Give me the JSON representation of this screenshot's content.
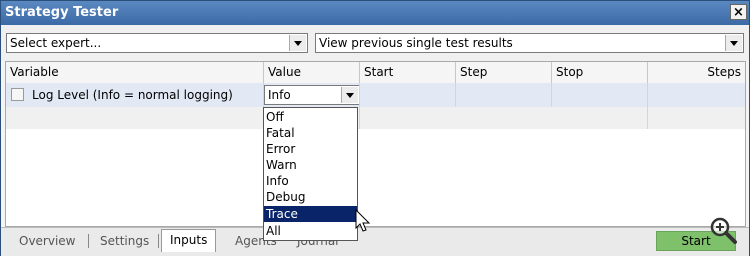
{
  "window": {
    "title": "Strategy Tester",
    "close_label": "×"
  },
  "toolbar": {
    "expert_select": "Select expert...",
    "mode_select": "View previous single test results"
  },
  "grid": {
    "columns": [
      "Variable",
      "Value",
      "Start",
      "Step",
      "Stop",
      "Steps"
    ],
    "row": {
      "variable": "Log Level (Info = normal logging)",
      "value": "Info"
    }
  },
  "dropdown": {
    "options": [
      "Off",
      "Fatal",
      "Error",
      "Warn",
      "Info",
      "Debug",
      "Trace",
      "All"
    ],
    "highlighted": "Trace"
  },
  "tabs": [
    "Overview",
    "Settings",
    "Inputs",
    "Agents",
    "Journal"
  ],
  "active_tab": "Inputs",
  "start_button": "Start",
  "colors": {
    "title_bar": "#3b6aa6",
    "selection": "#0a246a",
    "start_button": "#7fc06a",
    "row_highlight": "#e2e9f5"
  }
}
